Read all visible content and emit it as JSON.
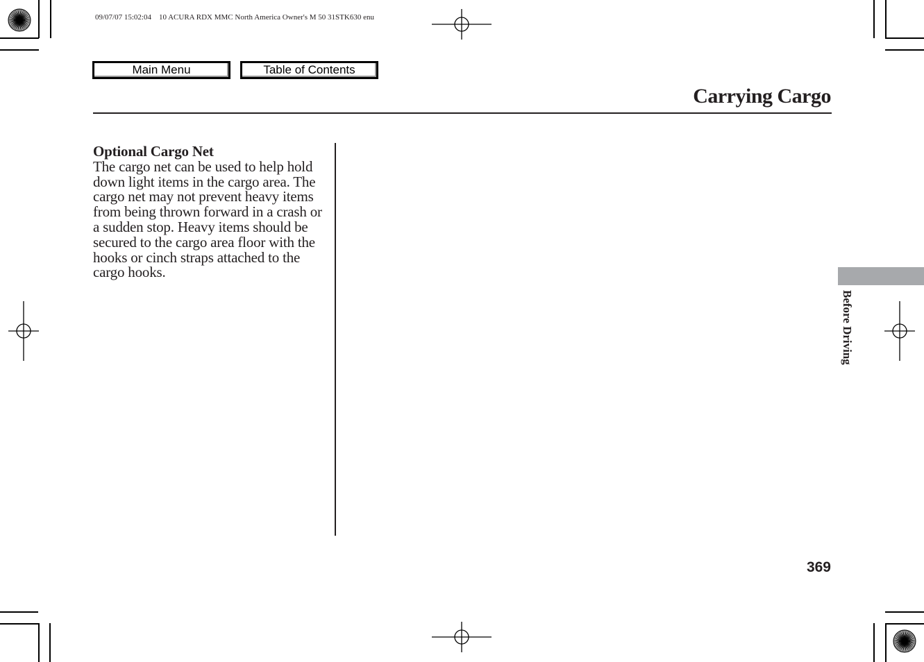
{
  "print_slug": "09/07/07 15:02:04    10 ACURA RDX MMC North America Owner's M 50 31STK630 enu",
  "nav": {
    "main_menu_label": "Main Menu",
    "toc_label": "Table of Contents"
  },
  "page": {
    "title": "Carrying Cargo",
    "section_tab": "Before Driving",
    "number": "369"
  },
  "content": {
    "heading": "Optional Cargo Net",
    "body": "The cargo net can be used to help hold down light items in the cargo area. The cargo net may not prevent heavy items from being thrown forward in a crash or a sudden stop. Heavy items should be secured to the cargo area floor with the hooks or cinch straps attached to the cargo hooks."
  },
  "colors": {
    "text": "#231f20",
    "tab_gray": "#a7a9ac"
  }
}
